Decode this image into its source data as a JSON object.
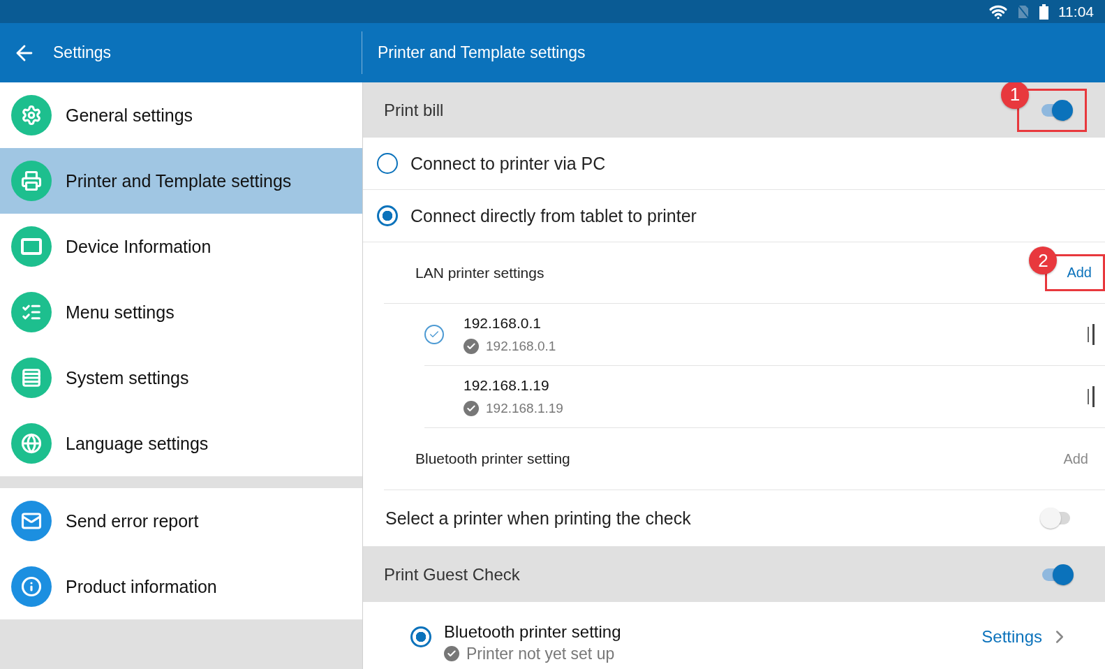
{
  "status_bar": {
    "time": "11:04"
  },
  "app_bar": {
    "title": "Settings",
    "section_title": "Printer and Template settings"
  },
  "sidebar": {
    "groups": [
      {
        "items": [
          {
            "label": "General settings",
            "selected": false,
            "color": "#1dbf8e"
          },
          {
            "label": "Printer and Template settings",
            "selected": true,
            "color": "#1dbf8e"
          },
          {
            "label": "Device Information",
            "selected": false,
            "color": "#1dbf8e"
          },
          {
            "label": "Menu settings",
            "selected": false,
            "color": "#1dbf8e"
          },
          {
            "label": "System settings",
            "selected": false,
            "color": "#1dbf8e"
          },
          {
            "label": "Language settings",
            "selected": false,
            "color": "#1dbf8e"
          }
        ]
      },
      {
        "items": [
          {
            "label": "Send error report",
            "selected": false,
            "color": "#1c8fe0"
          },
          {
            "label": "Product information",
            "selected": false,
            "color": "#1c8fe0"
          }
        ]
      }
    ]
  },
  "print_bill": {
    "title": "Print bill",
    "on": true,
    "callout": "1"
  },
  "connection_options": [
    {
      "label": "Connect to printer via PC",
      "selected": false
    },
    {
      "label": "Connect directly from tablet to printer",
      "selected": true
    }
  ],
  "lan": {
    "title": "LAN printer settings",
    "action": "Add",
    "action_enabled": true,
    "callout": "2",
    "printers": [
      {
        "name": "192.168.0.1",
        "address": "192.168.0.1",
        "selected": true
      },
      {
        "name": "192.168.1.19",
        "address": "192.168.1.19",
        "selected": false
      }
    ]
  },
  "bluetooth": {
    "title": "Bluetooth printer setting",
    "action": "Add",
    "action_enabled": false
  },
  "select_printer": {
    "label": "Select a printer when printing the check",
    "on": false
  },
  "guest_check": {
    "title": "Print Guest Check",
    "on": true,
    "options": [
      {
        "title": "Bluetooth printer setting",
        "status": "Printer not yet set up",
        "selected": true,
        "action": "Settings"
      }
    ]
  }
}
